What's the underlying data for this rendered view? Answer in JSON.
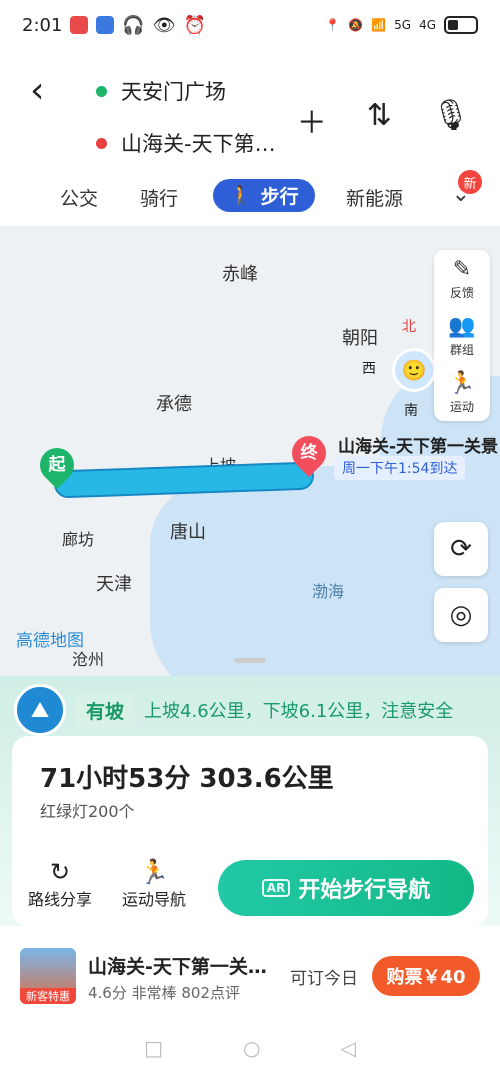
{
  "status_bar": {
    "time": "2:01",
    "net_labels": [
      "5G",
      "4G"
    ]
  },
  "header": {
    "origin": "天安门广场",
    "destination": "山海关-天下第…",
    "colors": {
      "origin_dot": "#1cb56a",
      "dest_dot": "#e84040"
    }
  },
  "tabs": [
    {
      "label": "公交",
      "active": false
    },
    {
      "label": "骑行",
      "active": false
    },
    {
      "label": "步行",
      "active": true
    },
    {
      "label": "新能源",
      "active": false
    }
  ],
  "new_badge": "新",
  "map": {
    "cities": [
      "赤峰",
      "朝阳",
      "承德",
      "上坡",
      "廊坊",
      "唐山",
      "天津",
      "渤海",
      "沧州"
    ],
    "start_pin": "起",
    "end_pin": "终",
    "dest_label": "山海关-天下第一关景",
    "arrival": "周一下午1:54到达",
    "directions": {
      "north": "北",
      "west": "西",
      "south": "南"
    },
    "logo": "高德地图",
    "side_panel": [
      {
        "label": "反馈",
        "icon": "pencil-icon"
      },
      {
        "label": "群组",
        "icon": "group-icon"
      },
      {
        "label": "运动",
        "icon": "sport-icon"
      }
    ]
  },
  "slope": {
    "tag": "有坡",
    "text": "上坡4.6公里，下坡6.1公里，注意安全"
  },
  "summary": {
    "duration_distance": "71小时53分  303.6公里",
    "lights": "红绿灯200个"
  },
  "actions": {
    "share": "路线分享",
    "sport_nav": "运动导航",
    "start_nav": "开始步行导航",
    "ar": "AR"
  },
  "promo": {
    "title": "山海关-天下第一关…",
    "meta": "4.6分  非常棒  802点评",
    "today": "可订今日",
    "ticket": "购票￥40",
    "thumb_tag": "新客特惠"
  }
}
